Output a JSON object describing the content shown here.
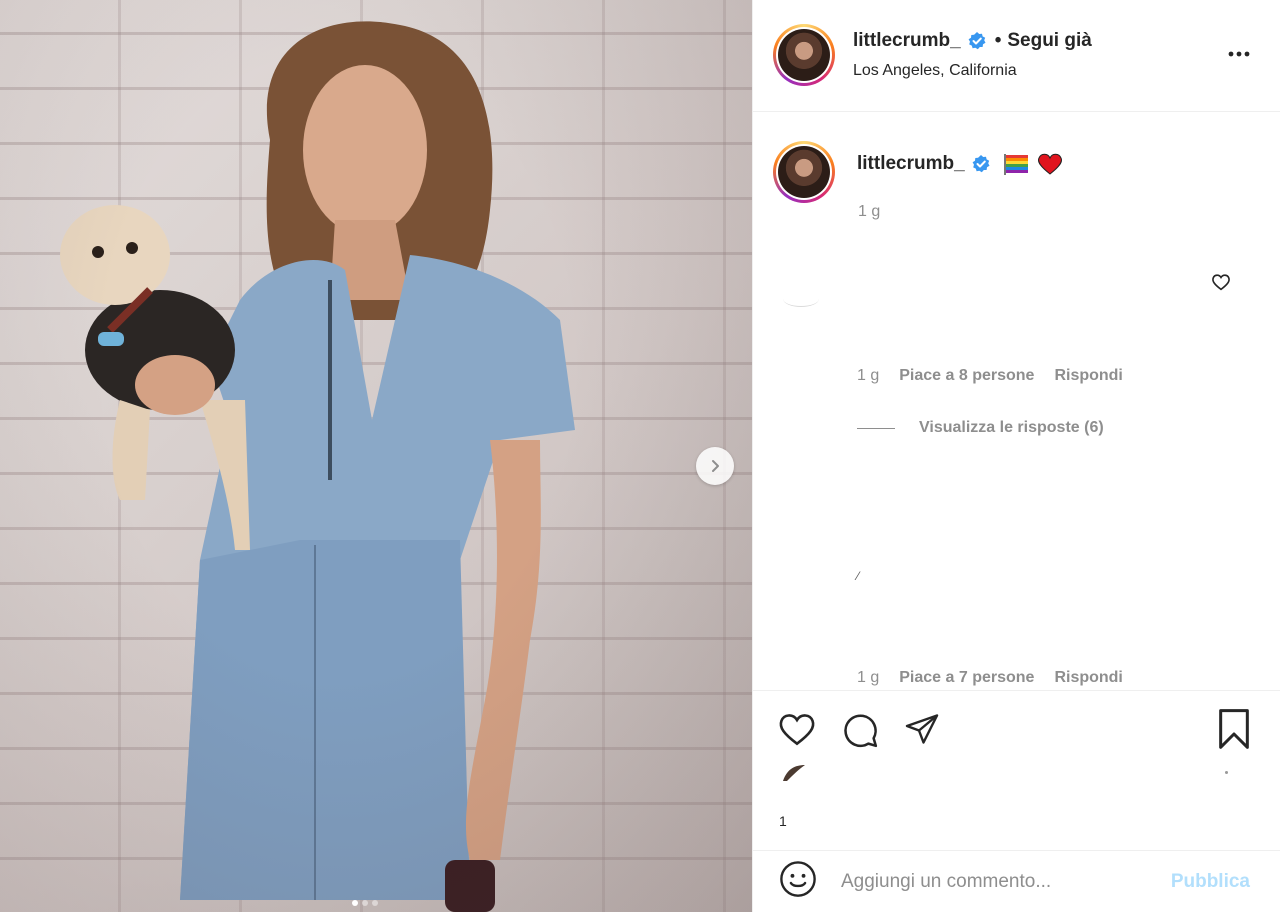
{
  "post": {
    "username": "littlecrumb_",
    "follow_status": "Segui già",
    "separator": "•",
    "location": "Los Angeles, California"
  },
  "caption": {
    "username": "littlecrumb_",
    "emojis": [
      "rainbow-flag",
      "red-heart"
    ],
    "time": "1 g"
  },
  "comments": [
    {
      "time": "1 g",
      "likes": "Piace a 8 persone",
      "reply": "Rispondi",
      "view_replies": "Visualizza le risposte (6)"
    },
    {
      "time": "1 g",
      "likes": "Piace a 7 persone",
      "reply": "Rispondi"
    }
  ],
  "actions": {
    "likes_count": "1"
  },
  "comment_box": {
    "placeholder": "Aggiungi un commento...",
    "publish": "Pubblica"
  },
  "carousel": {
    "slides": 3,
    "active": 1
  },
  "colors": {
    "verified": "#3897f0",
    "publish_disabled": "#b2dffc",
    "muted": "#8e8e8e"
  }
}
